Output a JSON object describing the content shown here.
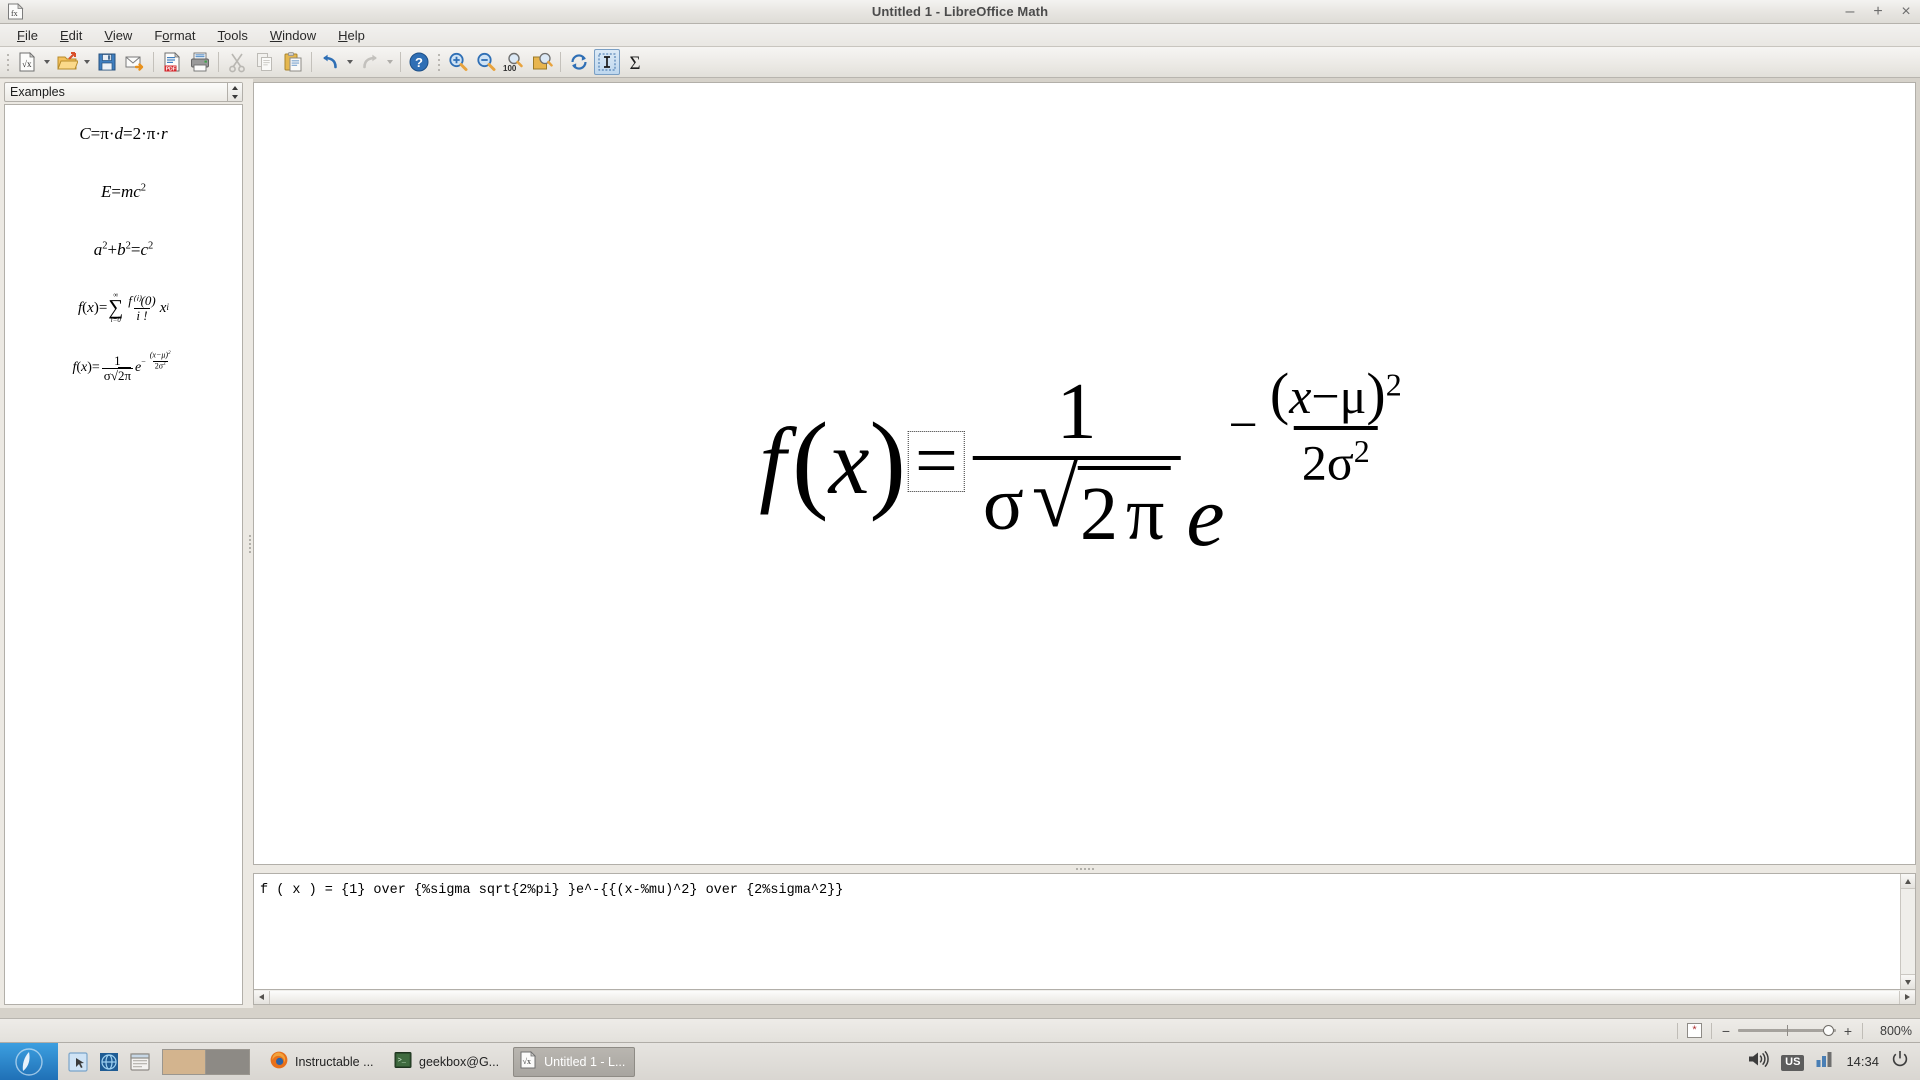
{
  "window": {
    "title": "Untitled 1 - LibreOffice Math",
    "app_icon": "libreoffice-math-icon",
    "controls": {
      "minimize": "–",
      "maximize": "+",
      "close": "×"
    }
  },
  "menubar": {
    "items": [
      {
        "label": "File",
        "accel": "F"
      },
      {
        "label": "Edit",
        "accel": "E"
      },
      {
        "label": "View",
        "accel": "V"
      },
      {
        "label": "Format",
        "accel": "o"
      },
      {
        "label": "Tools",
        "accel": "T"
      },
      {
        "label": "Window",
        "accel": "W"
      },
      {
        "label": "Help",
        "accel": "H"
      }
    ]
  },
  "toolbar": {
    "buttons": [
      {
        "name": "new-document",
        "icon": "new-formula-icon",
        "label": "New"
      },
      {
        "name": "open-document",
        "icon": "open-folder-icon",
        "label": "Open"
      },
      {
        "name": "save-document",
        "icon": "floppy-save-icon",
        "label": "Save"
      },
      {
        "name": "attach-to-email",
        "icon": "envelope-icon",
        "label": "Attach to E-mail"
      },
      {
        "name": "export-pdf",
        "icon": "pdf-icon",
        "label": "Export as PDF"
      },
      {
        "name": "print",
        "icon": "printer-icon",
        "label": "Print"
      },
      {
        "name": "cut",
        "icon": "scissors-icon",
        "label": "Cut"
      },
      {
        "name": "copy",
        "icon": "copy-icon",
        "label": "Copy"
      },
      {
        "name": "paste",
        "icon": "clipboard-icon",
        "label": "Paste"
      },
      {
        "name": "undo",
        "icon": "undo-arrow-icon",
        "label": "Undo"
      },
      {
        "name": "redo",
        "icon": "redo-arrow-icon",
        "label": "Redo"
      },
      {
        "name": "help",
        "icon": "help-question-icon",
        "label": "LibreOffice Help"
      },
      {
        "name": "zoom-in",
        "icon": "zoom-in-icon",
        "label": "Zoom In"
      },
      {
        "name": "zoom-out",
        "icon": "zoom-out-icon",
        "label": "Zoom Out"
      },
      {
        "name": "zoom-100",
        "icon": "zoom-100-icon",
        "label": "Zoom 100%"
      },
      {
        "name": "zoom-all",
        "icon": "show-all-icon",
        "label": "Show All"
      },
      {
        "name": "refresh",
        "icon": "refresh-icon",
        "label": "Update"
      },
      {
        "name": "formula-cursor",
        "icon": "formula-cursor-icon",
        "label": "Formula Cursor"
      },
      {
        "name": "elements-panel",
        "icon": "sigma-icon",
        "label": "Elements"
      }
    ],
    "zoom_100_label": "100"
  },
  "sidebar": {
    "selector_label": "Examples",
    "examples": [
      {
        "name": "example-circumference",
        "tex": "C = π·d = 2·π·r"
      },
      {
        "name": "example-mass-energy",
        "tex": "E = mc²"
      },
      {
        "name": "example-pythagoras",
        "tex": "a² + b² = c²"
      },
      {
        "name": "example-taylor-series",
        "tex": "f(x) = ∑ f⁽ⁱ⁾(0)/i! xⁱ"
      },
      {
        "name": "example-gaussian",
        "tex": "f(x) = 1/(σ√2π) e^-((x-μ)²/2σ²)"
      }
    ],
    "example_parts": {
      "circumference": {
        "c": "C",
        "eq1": "=",
        "pi1": "π",
        "dot1": "·",
        "d": "d",
        "eq2": "=",
        "two": "2",
        "dot2": "·",
        "pi2": "π",
        "dot3": "·",
        "r": "r"
      },
      "energy": {
        "e": "E",
        "eq": "=",
        "m": "m",
        "c": "c",
        "exp": "2"
      },
      "pythagoras": {
        "a": "a",
        "aexp": "2",
        "plus": "+",
        "b": "b",
        "bexp": "2",
        "eq": "=",
        "c": "c",
        "cexp": "2"
      },
      "taylor": {
        "f": "f",
        "lp": "(",
        "x": "x",
        "rp": ")",
        "eq": "=",
        "sigma": "∑",
        "top": "∞",
        "bottom": "i=0",
        "num": "f⁽ⁱ⁾(0)",
        "den": "i !",
        "xi": "x",
        "xiexp": "i"
      },
      "gaussian": {
        "f": "f",
        "lp": "(",
        "x": "x",
        "rp": ")",
        "eq": "=",
        "num": "1",
        "den_sigma": "σ",
        "den_sqrt": "√",
        "den_rad": "2π",
        "e": "e",
        "expminus": "−",
        "expnum": "(x−μ)",
        "expnum_pow": "2",
        "expden": "2σ",
        "expden_pow": "2"
      }
    }
  },
  "formula": {
    "name": "gaussian-pdf",
    "parts": {
      "f": "f",
      "lparen": "(",
      "x": "x",
      "rparen": ")",
      "equals": "=",
      "numerator": "1",
      "den_sigma": "σ",
      "den_radical": "√",
      "den_radicand_2": "2",
      "den_radicand_pi": "π",
      "e": "e",
      "exp_minus": "−",
      "exp_num_lparen": "(",
      "exp_num_x": "x",
      "exp_num_minus": "−",
      "exp_num_mu": "μ",
      "exp_num_rparen": ")",
      "exp_num_power": "2",
      "exp_den_2": "2",
      "exp_den_sigma": "σ",
      "exp_den_power": "2"
    },
    "selected_token": "="
  },
  "command": {
    "text": "f ( x ) = {1} over {%sigma sqrt{2%pi} }e^-{{(x-%mu)^2} over {2%sigma^2}}"
  },
  "statusbar": {
    "modified_marker": "*",
    "zoom_level": "800%"
  },
  "taskbar": {
    "start_label": "start-menu",
    "quicklaunch": [
      {
        "name": "file-manager-icon"
      },
      {
        "name": "network-globe-icon"
      },
      {
        "name": "terminal-window-icon"
      }
    ],
    "desktops": [
      {
        "name": "desktop-1",
        "active": true
      },
      {
        "name": "desktop-2",
        "active": false
      }
    ],
    "tasks": [
      {
        "name": "task-firefox",
        "label": "Instructable ...",
        "icon": "firefox-icon",
        "active": false
      },
      {
        "name": "task-terminal",
        "label": "geekbox@G...",
        "icon": "terminal-icon",
        "active": false
      },
      {
        "name": "task-libreoffice",
        "label": "Untitled 1 - L...",
        "icon": "math-icon",
        "active": true
      }
    ],
    "tray": {
      "volume": "volume-icon",
      "keyboard_layout": "US",
      "network": "signal-bars-icon",
      "clock": "14:34",
      "power": "power-icon"
    }
  },
  "colors": {
    "accent": "#3c9fe0",
    "chrome": "#ece9e3",
    "canvas": "#ffffff",
    "selection_border": "#333333"
  }
}
